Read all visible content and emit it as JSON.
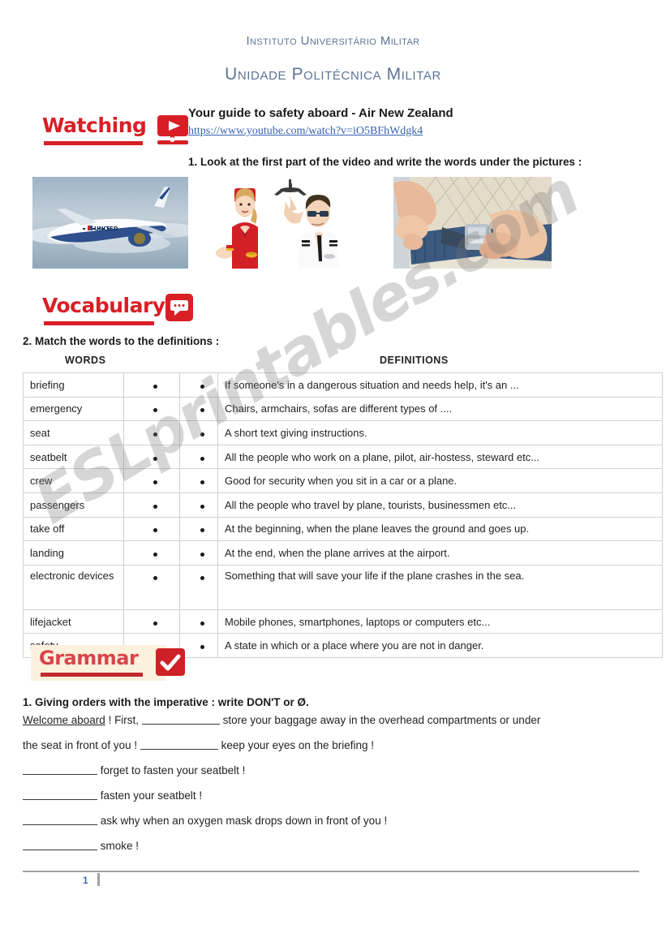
{
  "institution": {
    "line1": "Instituto Universitário Militar",
    "line2": "Unidade Politécnica Militar",
    "color": "#5d7495"
  },
  "watching": {
    "badge_label": "Watching",
    "icon": "video-play-icon",
    "accent_color": "#d81f26",
    "lesson_title": "Your guide to safety aboard  -  Air New Zealand",
    "url": "https://www.youtube.com/watch?v=iO5BFhWdgk4",
    "task": "1. Look at the first part of the video and write the words under the pictures :"
  },
  "photos": [
    {
      "name": "airplane-in-flight",
      "caption_blank": ""
    },
    {
      "name": "flight-attendant",
      "caption_blank": ""
    },
    {
      "name": "pilot-with-model-plane",
      "caption_blank": ""
    },
    {
      "name": "fastening-seatbelt",
      "caption_blank": ""
    }
  ],
  "vocabulary": {
    "badge_label": "Vocabulary",
    "icon": "speech-bubble-icon",
    "accent_color": "#d81f26",
    "task": "2. Match the words to the definitions :",
    "column_headers": {
      "words": "WORDS",
      "definitions": "DEFINITIONS"
    },
    "rows": [
      {
        "word": "briefing",
        "definition": "If someone's in a dangerous situation and needs help, it's an ..."
      },
      {
        "word": "emergency",
        "definition": "Chairs, armchairs, sofas are different types of ...."
      },
      {
        "word": "seat",
        "definition": "A short text giving instructions."
      },
      {
        "word": "seatbelt",
        "definition": "All the people who work on a plane, pilot, air-hostess, steward etc..."
      },
      {
        "word": "crew",
        "definition": "Good for security when you sit in a car or a plane."
      },
      {
        "word": "passengers",
        "definition": "All the people who travel by plane, tourists, businessmen etc..."
      },
      {
        "word": "take off",
        "definition": "At the beginning, when the plane leaves the ground and goes up."
      },
      {
        "word": "landing",
        "definition": "At the end, when the plane arrives at the airport."
      },
      {
        "word": "electronic devices",
        "definition": "Something that will save your life if the plane crashes in the sea."
      },
      {
        "word": "lifejacket",
        "definition": "Mobile phones, smartphones, laptops or computers etc..."
      },
      {
        "word": "safety",
        "definition": "A state in which or a place where you are not in danger."
      }
    ]
  },
  "grammar": {
    "badge_label": "Grammar",
    "icon": "checkmark-icon",
    "accent_color": "#c1272d",
    "band_color": "#fbf1dd",
    "task": "1. Giving orders with the imperative : write DON'T or Ø.",
    "exercise": {
      "line1_lead": "Welcome aboard",
      "line1_a": " !  First,",
      "line1_b": "store your baggage away in the overhead compartments or under",
      "line2_a": "the seat in front of you !",
      "line2_b": "keep your eyes on the briefing !",
      "line3": "forget to fasten your seatbelt !",
      "line4": "fasten your seatbelt !",
      "line5": "ask why when an oxygen mask drops down in front of you !",
      "line6": "smoke !"
    }
  },
  "footer": {
    "page_number": "1"
  },
  "watermark": {
    "text": "ESLprintables.com"
  }
}
